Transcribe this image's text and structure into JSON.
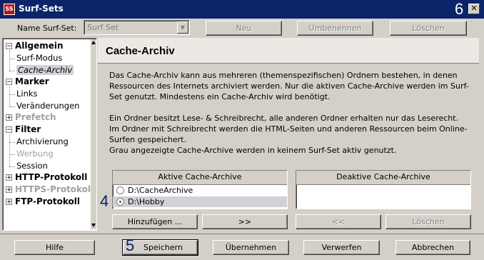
{
  "window": {
    "title": "Surf-Sets",
    "app_icon_text": "SS",
    "marker_top_right": "6"
  },
  "topbar": {
    "name_label": "Name Surf-Set:",
    "combo_value": "Surf Set",
    "buttons": {
      "new": "Neu",
      "rename": "Umbenennen",
      "delete": "Löschen"
    }
  },
  "tree": {
    "groups": [
      {
        "label": "Allgemein",
        "expanded": true,
        "enabled": true,
        "children": [
          {
            "label": "Surf-Modus",
            "enabled": true,
            "selected": false
          },
          {
            "label": "Cache-Archiv",
            "enabled": true,
            "selected": true
          }
        ]
      },
      {
        "label": "Marker",
        "expanded": true,
        "enabled": true,
        "children": [
          {
            "label": "Links",
            "enabled": true,
            "selected": false
          },
          {
            "label": "Veränderungen",
            "enabled": true,
            "selected": false
          }
        ]
      },
      {
        "label": "Prefetch",
        "expanded": false,
        "enabled": false,
        "children": []
      },
      {
        "label": "Filter",
        "expanded": true,
        "enabled": true,
        "children": [
          {
            "label": "Archivierung",
            "enabled": true,
            "selected": false
          },
          {
            "label": "Werbung",
            "enabled": false,
            "selected": false
          },
          {
            "label": "Session",
            "enabled": true,
            "selected": false
          }
        ]
      },
      {
        "label": "HTTP-Protokoll",
        "expanded": false,
        "enabled": true,
        "children": []
      },
      {
        "label": "HTTPS-Protokoll",
        "expanded": false,
        "enabled": false,
        "children": []
      },
      {
        "label": "FTP-Protokoll",
        "expanded": false,
        "enabled": true,
        "children": []
      }
    ]
  },
  "content": {
    "heading": "Cache-Archiv",
    "para1": "Das Cache-Archiv kann aus mehreren (themenspezifischen) Ordnern bestehen, in denen Ressourcen des Internets archiviert werden. Nur die aktiven Cache-Archive werden im Surf-Set genutzt. Mindestens ein Cache-Archiv wird benötigt.",
    "para2": "Ein Ordner besitzt Lese- & Schreibrecht, alle anderen Ordner erhalten nur das Leserecht. Im Ordner mit Schreibrecht werden die HTML-Seiten und anderen Ressourcen beim Online-Surfen gespeichert.",
    "para3": "Grau angezeigte Cache-Archive werden in keinem Surf-Set aktiv genutzt.",
    "active_list": {
      "header": "Aktive Cache-Archive",
      "items": [
        {
          "label": "D:\\CacheArchive",
          "checked": false
        },
        {
          "label": "D:\\Hobby",
          "checked": true
        }
      ],
      "marker": "4"
    },
    "inactive_list": {
      "header": "Deaktive Cache-Archive",
      "items": []
    },
    "buttons": {
      "add": "Hinzufügen ...",
      "move_right": ">>",
      "move_left": "<<",
      "delete": "Löschen"
    }
  },
  "footer": {
    "help": "Hilfe",
    "save": "Speichern",
    "save_marker": "5",
    "apply": "Übernehmen",
    "discard": "Verwerfen",
    "cancel": "Abbrechen"
  },
  "colors": {
    "titlebar": "#0a246a",
    "face": "#d4d0c8",
    "selection": "#d4d0d8"
  }
}
